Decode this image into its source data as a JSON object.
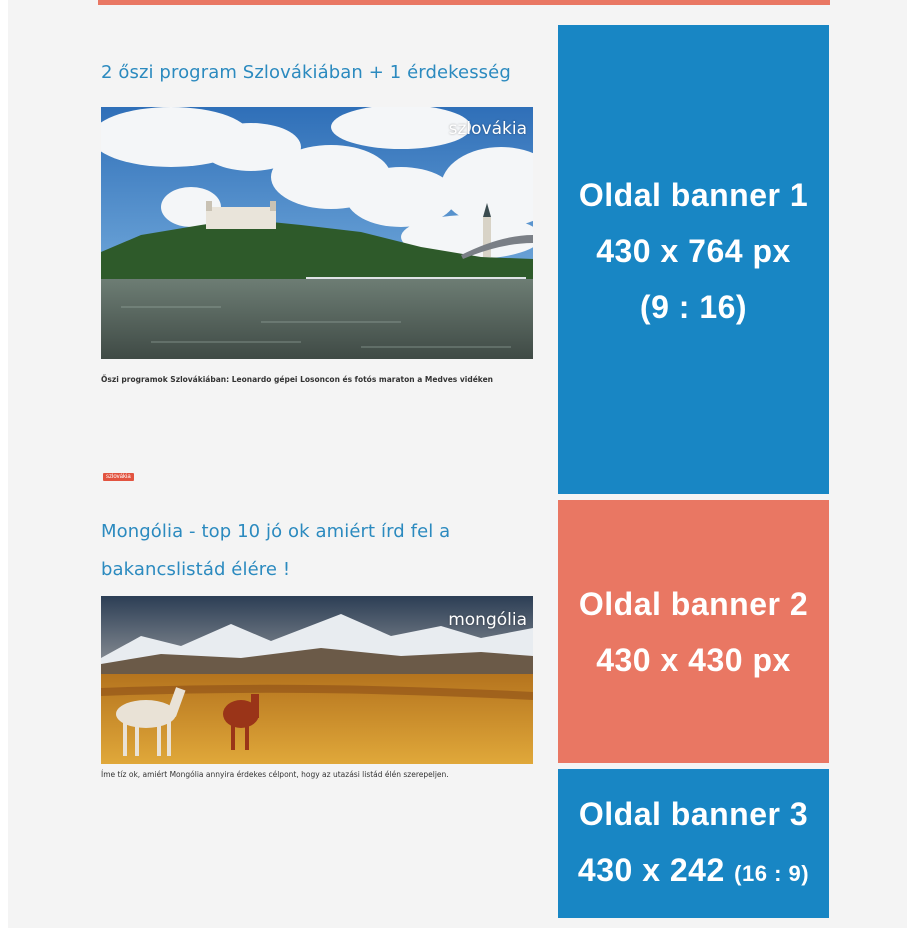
{
  "articles": [
    {
      "title": "2 őszi program Szlovákiában + 1 érdekesség",
      "image_label": "szlovákia",
      "caption": "Őszi programok Szlovákiában:  Leonardo gépei Losoncon és fotós maraton a Medves vidéken"
    },
    {
      "tag": "szlovákia",
      "title": "Mongólia - top 10 jó ok amiért írd fel a bakancslistád élére !",
      "image_label": "mongólia",
      "caption": "Íme tíz ok, amiért Mongólia annyira érdekes célpont, hogy  az utazási listád élén szerepeljen."
    }
  ],
  "banners": [
    {
      "line1": "Oldal banner 1",
      "line2": "430 x 764 px",
      "line3": "(9 : 16)",
      "color": "#1886c4"
    },
    {
      "line1": "Oldal banner 2",
      "line2": "430 x 430 px",
      "color": "#e97763"
    },
    {
      "line1": "Oldal banner 3",
      "line2": "430 x 242",
      "ratio": "(16 : 9)",
      "color": "#1886c4"
    }
  ],
  "colors": {
    "accent_blue": "#1886c4",
    "accent_coral": "#e97763",
    "title_blue": "#2b8abf",
    "tag_red": "#e2533f"
  }
}
